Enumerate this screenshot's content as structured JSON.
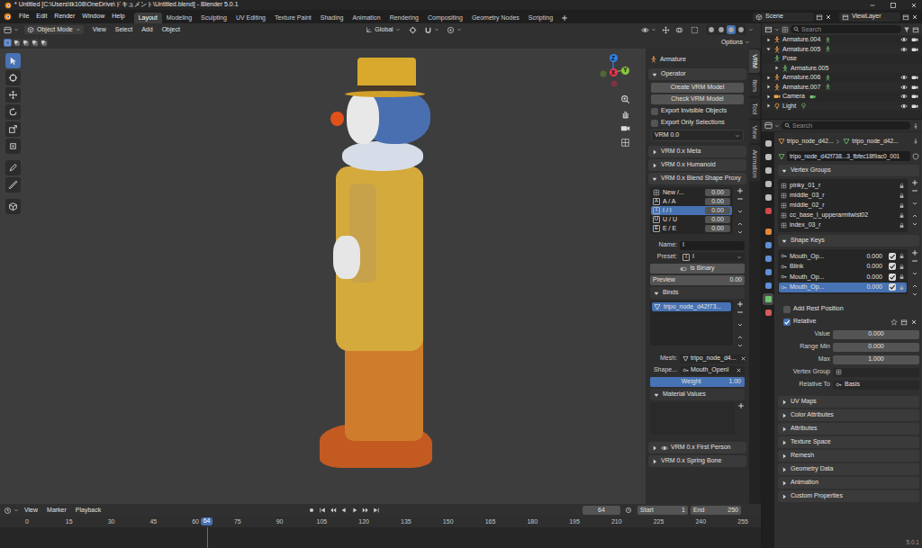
{
  "window": {
    "title": "* Untitled [C:\\Users\\tk108\\OneDrive\\ドキュメント\\Untitled.blend] - Blender 5.0.1"
  },
  "menus": [
    "File",
    "Edit",
    "Render",
    "Window",
    "Help"
  ],
  "workspaces": [
    {
      "label": "Layout",
      "selected": true
    },
    {
      "label": "Modeling",
      "selected": false
    },
    {
      "label": "Sculpting",
      "selected": false
    },
    {
      "label": "UV Editing",
      "selected": false
    },
    {
      "label": "Texture Paint",
      "selected": false
    },
    {
      "label": "Shading",
      "selected": false
    },
    {
      "label": "Animation",
      "selected": false
    },
    {
      "label": "Rendering",
      "selected": false
    },
    {
      "label": "Compositing",
      "selected": false
    },
    {
      "label": "Geometry Nodes",
      "selected": false
    },
    {
      "label": "Scripting",
      "selected": false
    }
  ],
  "scene": "Scene",
  "view_layer": "ViewLayer",
  "viewport": {
    "mode": "Object Mode",
    "menus": [
      "View",
      "Select",
      "Add",
      "Object"
    ],
    "orientation": "Global",
    "options": "Options",
    "select_modes": [
      {
        "selected": true
      },
      {
        "selected": false
      },
      {
        "selected": false
      },
      {
        "selected": false
      },
      {
        "selected": false
      }
    ],
    "shading_modes": [
      {
        "selected": false
      },
      {
        "selected": false
      },
      {
        "selected": true
      },
      {
        "selected": false
      }
    ],
    "tools": [
      {
        "selected": true
      },
      {
        "selected": false
      },
      {
        "selected": false
      },
      {
        "selected": false
      },
      {
        "selected": false
      },
      {
        "selected": false
      },
      {
        "selected": false
      },
      {
        "selected": false
      },
      {
        "selected": false
      }
    ],
    "gizmo": {
      "z": "Z",
      "y": "Y",
      "x": "X"
    }
  },
  "sidebar": {
    "title": "Armature",
    "operator": {
      "label": "Operator",
      "expanded": true,
      "buttons": [
        "Create VRM Model",
        "Check VRM Model"
      ],
      "checks": [
        {
          "label": "Export Invisible Objects",
          "checked": false
        },
        {
          "label": "Export Only Selections",
          "checked": false
        }
      ],
      "version": "VRM 0.0"
    },
    "panels_top": [
      {
        "label": "VRM 0.x Meta",
        "expanded": false
      },
      {
        "label": "VRM 0.x Humanoid",
        "expanded": false
      }
    ],
    "blend_shape": {
      "label": "VRM 0.x Blend Shape Proxy",
      "expanded": true,
      "items": [
        {
          "label": "New /...",
          "value": "0.00",
          "selected": false
        },
        {
          "icon": "A",
          "label": "A / A",
          "value": "0.00",
          "selected": false
        },
        {
          "icon": "I",
          "label": "I / I",
          "value": "0.00",
          "selected": true
        },
        {
          "icon": "U",
          "label": "U / U",
          "value": "0.00",
          "selected": false
        },
        {
          "icon": "E",
          "label": "E / E",
          "value": "0.00",
          "selected": false
        }
      ],
      "name_label": "Name:",
      "name": "I",
      "preset_label": "Preset:",
      "preset_icon": "I",
      "preset": "I",
      "is_binary": {
        "label": "Is Binary",
        "checked": false
      },
      "preview_label": "Preview",
      "preview": "0.00",
      "binds": {
        "label": "Binds",
        "expanded": true,
        "items": [
          {
            "label": "tripo_node_d42f73...",
            "selected": true
          }
        ]
      },
      "mesh_label": "Mesh:",
      "mesh": "tripo_node_d4...",
      "shape_label": "Shape...",
      "shape": "Mouth_OpenI",
      "weight": {
        "label": "Weight",
        "value": "1.00",
        "level": 1
      },
      "material_values": {
        "label": "Material Values",
        "expanded": true
      }
    },
    "panels_bottom": [
      {
        "label": "VRM 0.x First Person",
        "expanded": false
      },
      {
        "label": "VRM 0.x Spring Bone",
        "expanded": false
      }
    ]
  },
  "sidebar_tabs": [
    {
      "label": "VRM",
      "selected": true
    },
    {
      "label": "Item",
      "selected": false
    },
    {
      "label": "Tool",
      "selected": false
    },
    {
      "label": "View",
      "selected": false
    },
    {
      "label": "Animation",
      "selected": false
    }
  ],
  "timeline": {
    "menus": [
      "View",
      "Marker",
      "Playback"
    ],
    "current": "64",
    "start_label": "Start",
    "start": "1",
    "end_label": "End",
    "end": "250",
    "marker": {
      "label": "64",
      "frame": 64
    },
    "ticks": [
      {
        "label": "0",
        "frame": 0
      },
      {
        "label": "15",
        "frame": 15
      },
      {
        "label": "30",
        "frame": 30
      },
      {
        "label": "45",
        "frame": 45
      },
      {
        "label": "60",
        "frame": 60
      },
      {
        "label": "75",
        "frame": 75
      },
      {
        "label": "90",
        "frame": 90
      },
      {
        "label": "105",
        "frame": 105
      },
      {
        "label": "120",
        "frame": 120
      },
      {
        "label": "135",
        "frame": 135
      },
      {
        "label": "150",
        "frame": 150
      },
      {
        "label": "165",
        "frame": 165
      },
      {
        "label": "180",
        "frame": 180
      },
      {
        "label": "195",
        "frame": 195
      },
      {
        "label": "210",
        "frame": 210
      },
      {
        "label": "225",
        "frame": 225
      },
      {
        "label": "240",
        "frame": 240
      },
      {
        "label": "255",
        "frame": 255
      }
    ]
  },
  "outliner": {
    "search": "Search",
    "rows": [
      {
        "label": "Armature.004",
        "depth": 0,
        "kind": "armature",
        "expanded": false,
        "visible": true
      },
      {
        "label": "Armature.005",
        "depth": 0,
        "kind": "armature",
        "expanded": true,
        "visible": true
      },
      {
        "label": "Pose",
        "depth": 1,
        "kind": "pose"
      },
      {
        "label": "Armature.005",
        "depth": 1,
        "kind": "armature-data",
        "expanded": false
      },
      {
        "label": "Armature.006",
        "depth": 0,
        "kind": "armature",
        "expanded": false,
        "visible": true
      },
      {
        "label": "Armature.007",
        "depth": 0,
        "kind": "armature",
        "expanded": false,
        "visible": true
      },
      {
        "label": "Camera",
        "depth": 0,
        "kind": "camera",
        "expanded": false,
        "visible": true
      },
      {
        "label": "Light",
        "depth": 0,
        "kind": "light",
        "expanded": false,
        "visible": true
      }
    ]
  },
  "properties": {
    "search": "Search",
    "tabs": [
      {
        "selected": false
      },
      {
        "selected": false
      },
      {
        "selected": false
      },
      {
        "selected": false
      },
      {
        "selected": false
      },
      {
        "selected": false
      },
      {
        "selected": false
      },
      {
        "selected": false
      },
      {
        "selected": false
      },
      {
        "selected": false
      },
      {
        "selected": false
      },
      {
        "selected": true
      },
      {
        "selected": false
      }
    ],
    "breadcrumb": [
      "tripo_node_d42...",
      "tripo_node_d42..."
    ],
    "mesh_name": "tripo_node_d42f738...3_fbfec18f9ac0_001",
    "vertex_groups": {
      "label": "Vertex Groups",
      "expanded": true,
      "items": [
        {
          "label": "pinky_01_r",
          "selected": false
        },
        {
          "label": "middle_03_r",
          "selected": false
        },
        {
          "label": "middle_02_r",
          "selected": false
        },
        {
          "label": "cc_base_l_upperarmtwist02",
          "selected": false
        },
        {
          "label": "index_03_r",
          "selected": false
        }
      ]
    },
    "shape_keys": {
      "label": "Shape Keys",
      "expanded": true,
      "items": [
        {
          "label": "Mouth_Op...",
          "value": "0.000",
          "checked": true,
          "selected": false
        },
        {
          "label": "Blink",
          "value": "0.000",
          "checked": true,
          "selected": false
        },
        {
          "label": "Mouth_Op...",
          "value": "0.000",
          "checked": true,
          "selected": false
        },
        {
          "label": "Mouth_Op...",
          "value": "0.000",
          "checked": true,
          "selected": true
        }
      ]
    },
    "add_rest_position": {
      "label": "Add Rest Position",
      "checked": false
    },
    "relative": {
      "label": "Relative",
      "checked": true
    },
    "fields": [
      {
        "label": "Value",
        "value": "0.000",
        "kind": "number"
      },
      {
        "label": "Range Min",
        "value": "0.000",
        "kind": "number"
      },
      {
        "label": "Max",
        "value": "1.000",
        "kind": "number"
      },
      {
        "label": "Vertex Group",
        "kind": "search"
      },
      {
        "label": "Relative To",
        "value": "Basis",
        "kind": "search"
      }
    ],
    "sections": [
      {
        "label": "UV Maps",
        "expanded": false
      },
      {
        "label": "Color Attributes",
        "expanded": false
      },
      {
        "label": "Attributes",
        "expanded": false
      },
      {
        "label": "Texture Space",
        "expanded": false
      },
      {
        "label": "Remesh",
        "expanded": false
      },
      {
        "label": "Geometry Data",
        "expanded": false
      },
      {
        "label": "Animation",
        "expanded": false
      },
      {
        "label": "Custom Properties",
        "expanded": false
      }
    ]
  },
  "version": "5.0.1"
}
